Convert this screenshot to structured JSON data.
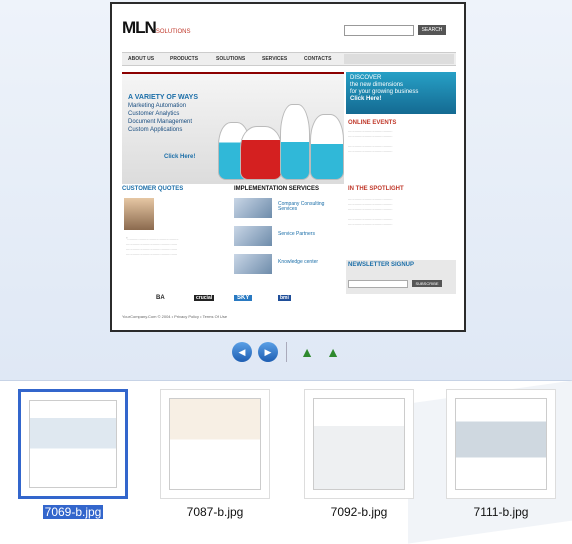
{
  "preview": {
    "logo_main": "MLN",
    "logo_sub": "SOLUTIONS",
    "search_label": "SEARCH",
    "nav": [
      "ABOUT US",
      "PRODUCTS",
      "SOLUTIONS",
      "SERVICES",
      "CONTACTS"
    ],
    "hero": {
      "title": "A VARIETY OF WAYS",
      "lines": [
        "Marketing Automation",
        "Customer Analytics",
        "Document Management",
        "Custom Applications"
      ],
      "cta": "Click Here!"
    },
    "discover": {
      "line1": "DISCOVER",
      "line2": "the new dimensions",
      "line3": "for your growing business",
      "cta": "Click Here!"
    },
    "online_events": "ONLINE EVENTS",
    "customer_quotes": "CUSTOMER QUOTES",
    "implementation": "IMPLEMENTATION SERVICES",
    "impl_items": [
      "Company Consulting Services",
      "Service Partners",
      "Knowledge center"
    ],
    "spotlight": "IN THE SPOTLIGHT",
    "newsletter": "NEWSLETTER SIGNUP",
    "subscribe": "SUBSCRIBE",
    "footer_logos": [
      "BA",
      "crucial",
      "SKY",
      "bmi"
    ],
    "copyright": "YourCompany.Com © 2004 • Privacy Policy • Terms Of Use"
  },
  "thumbnails": [
    {
      "label": "7069-b.jpg",
      "selected": true
    },
    {
      "label": "7087-b.jpg",
      "selected": false
    },
    {
      "label": "7092-b.jpg",
      "selected": false
    },
    {
      "label": "7111-b.jpg",
      "selected": false
    }
  ],
  "colors": {
    "accent": "#3366cc",
    "hero_blue": "#1b6ea8",
    "brand_red": "#c0392b"
  }
}
